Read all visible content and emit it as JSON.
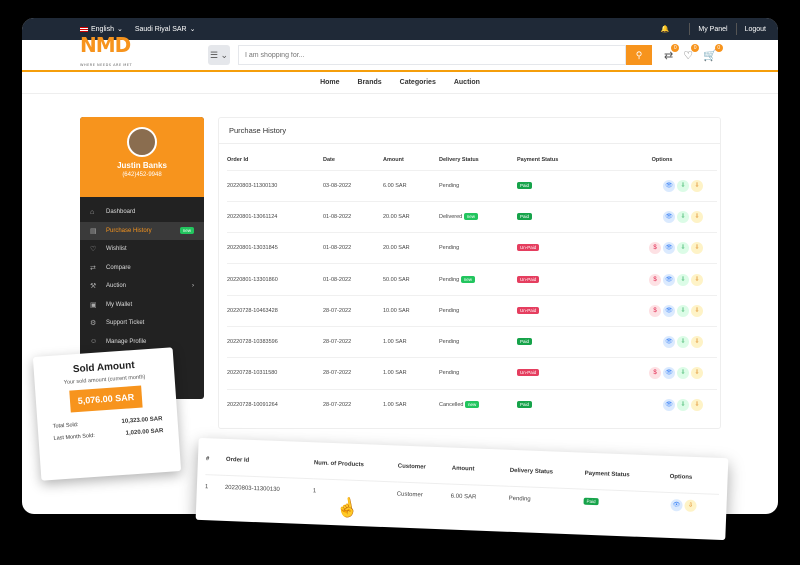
{
  "topbar": {
    "language": "English",
    "currency": "Saudi Riyal SAR",
    "my_panel": "My Panel",
    "logout": "Logout"
  },
  "header": {
    "logo": "NMD",
    "logo_tagline": "WHERE NEEDS ARE MET",
    "search_placeholder": "I am shopping for...",
    "compare_count": "0",
    "wishlist_count": "0",
    "cart_count": "0"
  },
  "nav": [
    "Home",
    "Brands",
    "Categories",
    "Auction"
  ],
  "user": {
    "name": "Justin Banks",
    "phone": "(642)452-9948"
  },
  "sidebar": [
    {
      "label": "Dashboard",
      "icon": "⌂"
    },
    {
      "label": "Purchase History",
      "icon": "▤",
      "tag": "new"
    },
    {
      "label": "Wishlist",
      "icon": "♡"
    },
    {
      "label": "Compare",
      "icon": "⇄"
    },
    {
      "label": "Auction",
      "icon": "⚒",
      "arrow": "›"
    },
    {
      "label": "My Wallet",
      "icon": "▣"
    },
    {
      "label": "Support Ticket",
      "icon": "⚙"
    },
    {
      "label": "Manage Profile",
      "icon": "☺"
    }
  ],
  "purchase": {
    "title": "Purchase History",
    "headers": [
      "Order Id",
      "Date",
      "Amount",
      "Delivery Status",
      "Payment Status",
      "Options"
    ],
    "rows": [
      {
        "id": "20220803-11300130",
        "date": "03-08-2022",
        "amount": "6.00 SAR",
        "delivery": "Pending",
        "dtag": "",
        "payment": "Paid",
        "cancel": false
      },
      {
        "id": "20220801-13061124",
        "date": "01-08-2022",
        "amount": "20.00 SAR",
        "delivery": "Delivered",
        "dtag": "new",
        "payment": "Paid",
        "cancel": false
      },
      {
        "id": "20220801-13031845",
        "date": "01-08-2022",
        "amount": "20.00 SAR",
        "delivery": "Pending",
        "dtag": "",
        "payment": "Un-Paid",
        "cancel": true
      },
      {
        "id": "20220801-13301860",
        "date": "01-08-2022",
        "amount": "50.00 SAR",
        "delivery": "Pending",
        "dtag": "new",
        "payment": "Un-Paid",
        "cancel": true
      },
      {
        "id": "20220728-10463428",
        "date": "28-07-2022",
        "amount": "10.00 SAR",
        "delivery": "Pending",
        "dtag": "",
        "payment": "Un-Paid",
        "cancel": true
      },
      {
        "id": "20220728-10383596",
        "date": "28-07-2022",
        "amount": "1.00 SAR",
        "delivery": "Pending",
        "dtag": "",
        "payment": "Paid",
        "cancel": false
      },
      {
        "id": "20220728-10311580",
        "date": "28-07-2022",
        "amount": "1.00 SAR",
        "delivery": "Pending",
        "dtag": "",
        "payment": "Un-Paid",
        "cancel": true
      },
      {
        "id": "20220728-10091264",
        "date": "28-07-2022",
        "amount": "1.00 SAR",
        "delivery": "Cancelled",
        "dtag": "new",
        "payment": "Paid",
        "cancel": false
      }
    ]
  },
  "sold_card": {
    "title": "Sold Amount",
    "subtitle": "Your sold amount (current month)",
    "amount": "5,076.00 SAR",
    "total_label": "Total Sold:",
    "total_value": "10,323.00 SAR",
    "last_label": "Last Month Sold:",
    "last_value": "1,020.00 SAR"
  },
  "overlay": {
    "headers": [
      "#",
      "Order Id",
      "Num. of Products",
      "Customer",
      "Amount",
      "Delivery Status",
      "Payment Status",
      "Options"
    ],
    "row": {
      "num": "1",
      "id": "20220803-11300130",
      "products": "1",
      "customer": "Customer",
      "amount": "6.00 SAR",
      "delivery": "Pending",
      "payment": "Paid"
    }
  }
}
